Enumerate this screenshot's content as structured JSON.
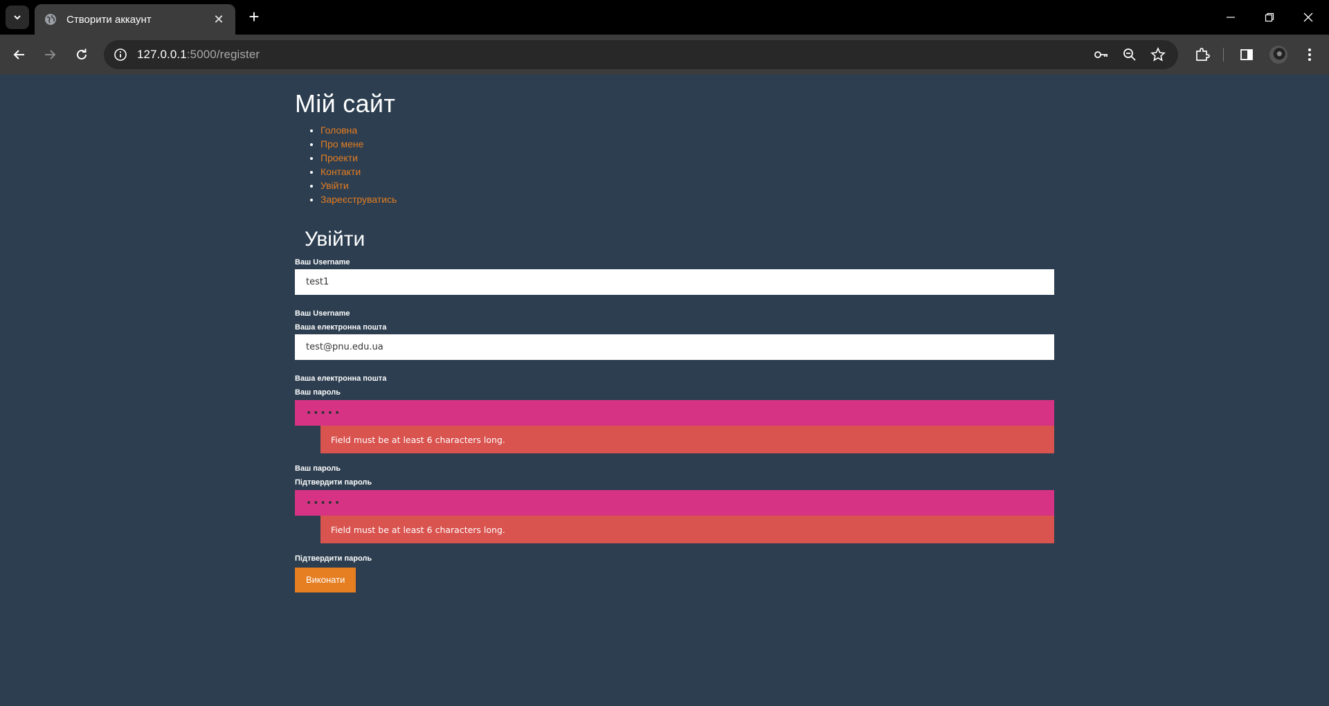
{
  "browser": {
    "tab_title": "Створити аккаунт",
    "url_host": "127.0.0.1",
    "url_path": ":5000/register"
  },
  "site": {
    "title": "Мій сайт",
    "nav": [
      {
        "label": "Головна"
      },
      {
        "label": "Про мене"
      },
      {
        "label": "Проекти"
      },
      {
        "label": "Контакти"
      },
      {
        "label": "Увійти"
      },
      {
        "label": "Зареєструватись"
      }
    ]
  },
  "form": {
    "title": "Увійти",
    "username": {
      "label": "Ваш Username",
      "value": "test1",
      "hint": "Ваш Username"
    },
    "email": {
      "label": "Ваша електронна пошта",
      "value": "test@pnu.edu.ua",
      "hint": "Ваша електронна пошта"
    },
    "password": {
      "label": "Ваш пароль",
      "value": "•••••",
      "error": "Field must be at least 6 characters long.",
      "hint": "Ваш пароль"
    },
    "confirm": {
      "label": "Підтвердити пароль",
      "value": "•••••",
      "error": "Field must be at least 6 characters long.",
      "hint": "Підтвердити пароль"
    },
    "submit_label": "Виконати"
  },
  "colors": {
    "page_bg": "#2c3e50",
    "accent": "#e67e22",
    "field_error_bg": "#d63384",
    "error_msg_bg": "#d9534f"
  }
}
